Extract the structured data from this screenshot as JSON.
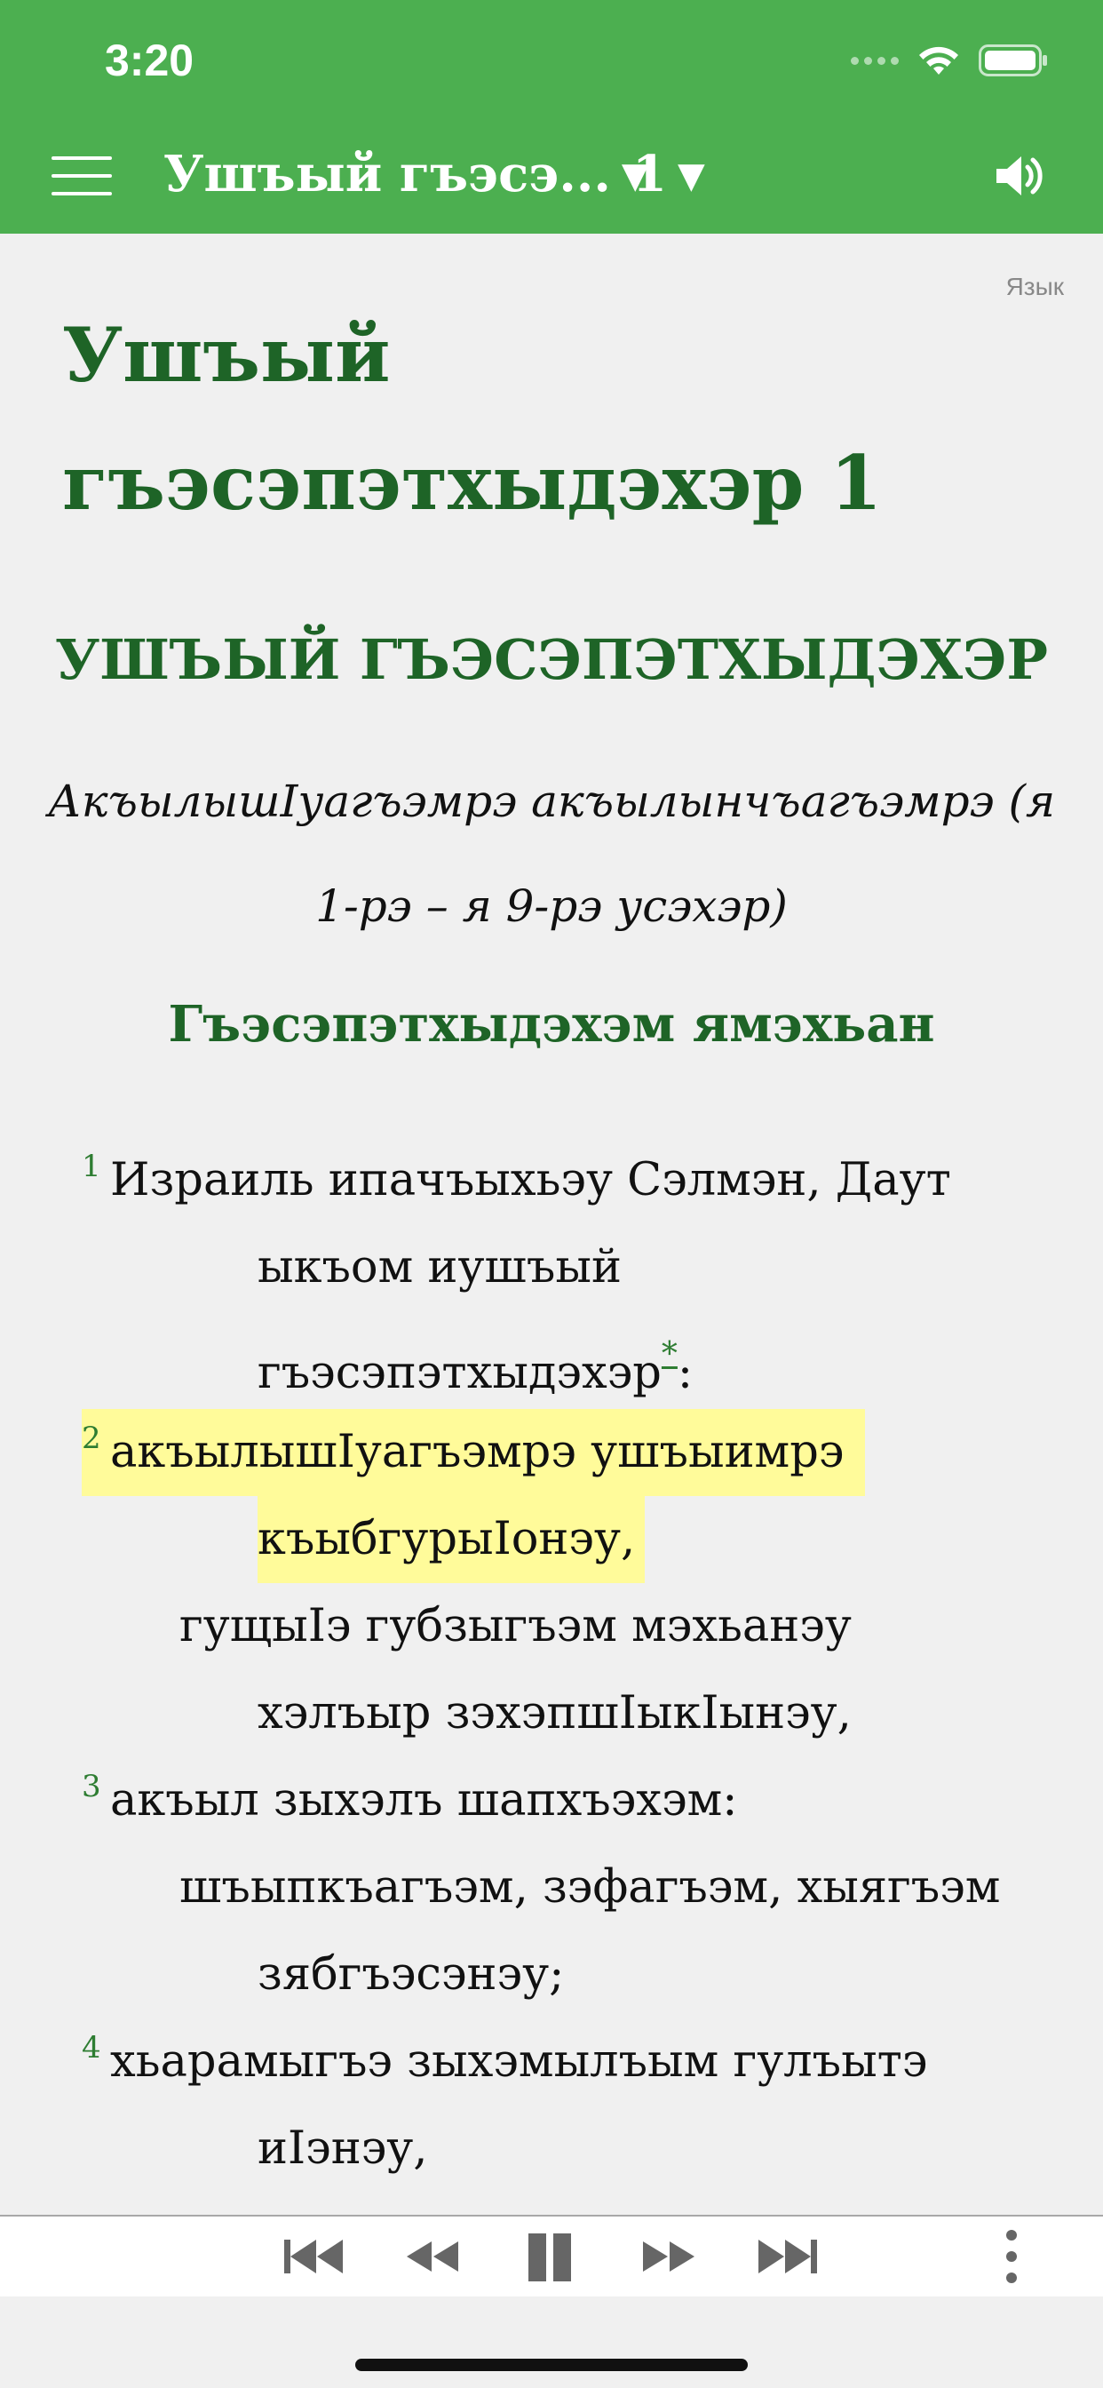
{
  "status_bar": {
    "time": "3:20"
  },
  "toolbar": {
    "book_label": "Ушъый гъэсэ...",
    "chapter_label": "1",
    "caret": "▼"
  },
  "content": {
    "language_link": "Язык",
    "chapter_title": "Ушъый гъэсэпэтхыдэхэр 1",
    "book_heading": "УШЪЫЙ ГЪЭСЭПЭТХЫДЭХЭР",
    "book_subtitle": "АкъылышIуагъэмрэ акъылынчъагъэмрэ (я 1-рэ – я 9-рэ усэхэр)",
    "section_heading": "Гъэсэпэтхыдэхэм ямэхьан",
    "verse_numbers": [
      "1",
      "2",
      "3",
      "4"
    ],
    "lines": [
      "Израиль ипачъыхьэу Сэлмэн, Даут",
      "ыкъом иушъый",
      "гъэсэпэтхыдэхэр",
      ":",
      "акъылышIуагъэмрэ ушъыимрэ",
      "къыбгурыIонэу,",
      "гущыIэ губзыгъэм мэхьанэу",
      "хэлъыр зэхэпшIыкIынэу,",
      "акъыл зыхэлъ шапхъэхэм:",
      "шъыпкъагъэм, зэфагъэм, хыягъэм",
      "зябгъэсэнэу;",
      "хьарамыгъэ зыхэмылъым гулъытэ",
      "иIэнэу,"
    ],
    "footnote_marker": "*",
    "highlight_color": "#fffb9a"
  },
  "colors": {
    "header": "#4caf50",
    "heading_green": "#1e6427",
    "verse_number_green": "#2e7d32",
    "background": "#f0f0f0"
  },
  "icons": {
    "menu": "hamburger-icon",
    "speaker": "speaker-icon",
    "wifi": "wifi-icon",
    "battery": "battery-icon",
    "skip_back": "skip-back-icon",
    "rewind": "rewind-icon",
    "pause": "pause-icon",
    "fast_forward": "fast-forward-icon",
    "skip_forward": "skip-forward-icon",
    "more": "more-vertical-icon"
  }
}
